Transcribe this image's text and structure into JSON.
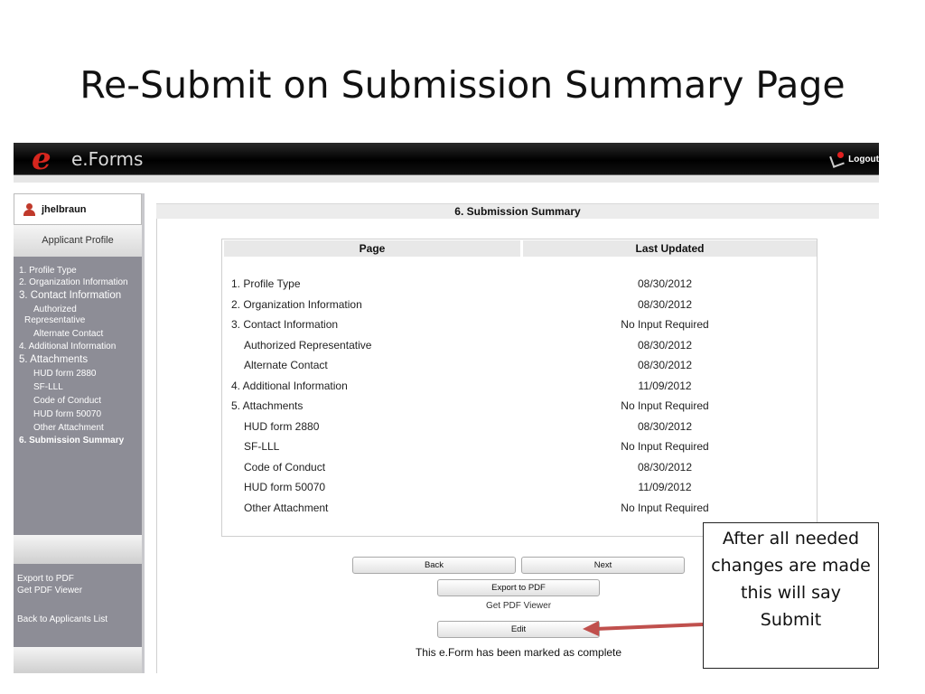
{
  "slide": {
    "title": "Re-Submit on Submission Summary Page"
  },
  "app": {
    "brand": "e.Forms",
    "logo_letter": "e",
    "logout_label": "Logout",
    "accent_color": "#d7261e"
  },
  "sidebar": {
    "username": "jhelbraun",
    "profile_label": "Applicant Profile",
    "nav": [
      {
        "label": "1. Profile Type"
      },
      {
        "label": "2. Organization Information"
      },
      {
        "label": "3. Contact Information"
      },
      {
        "label": "Authorized Representative"
      },
      {
        "label": "Alternate Contact"
      },
      {
        "label": "4. Additional Information"
      },
      {
        "label": "5. Attachments"
      },
      {
        "label": "HUD form 2880"
      },
      {
        "label": "SF-LLL"
      },
      {
        "label": "Code of Conduct"
      },
      {
        "label": "HUD form 50070"
      },
      {
        "label": "Other Attachment"
      },
      {
        "label": "6. Submission Summary"
      }
    ],
    "links": {
      "export_pdf": "Export to PDF",
      "get_pdf_viewer": "Get PDF Viewer",
      "back_to_list": "Back to Applicants List"
    }
  },
  "main": {
    "header": "6. Submission Summary",
    "table": {
      "columns": [
        "Page",
        "Last Updated"
      ],
      "rows": [
        {
          "page": "1. Profile Type",
          "updated": "08/30/2012"
        },
        {
          "page": "2. Organization Information",
          "updated": "08/30/2012"
        },
        {
          "page": "3. Contact Information",
          "updated": "No Input Required"
        },
        {
          "page": "Authorized Representative",
          "updated": "08/30/2012"
        },
        {
          "page": "Alternate Contact",
          "updated": "08/30/2012"
        },
        {
          "page": "4. Additional Information",
          "updated": "11/09/2012"
        },
        {
          "page": "5. Attachments",
          "updated": "No Input Required"
        },
        {
          "page": "HUD form 2880",
          "updated": "08/30/2012"
        },
        {
          "page": "SF-LLL",
          "updated": "No Input Required"
        },
        {
          "page": "Code of Conduct",
          "updated": "08/30/2012"
        },
        {
          "page": "HUD form 50070",
          "updated": "11/09/2012"
        },
        {
          "page": "Other Attachment",
          "updated": "No Input Required"
        }
      ]
    },
    "buttons": {
      "back": "Back",
      "next": "Next",
      "export_pdf": "Export to PDF",
      "get_pdf_viewer": "Get PDF Viewer",
      "edit": "Edit"
    },
    "status_message": "This e.Form has been marked as complete"
  },
  "callout": {
    "lines": [
      "After all needed",
      "changes are made",
      "this will say",
      "Submit"
    ],
    "arrow_color": "#c0504d"
  }
}
